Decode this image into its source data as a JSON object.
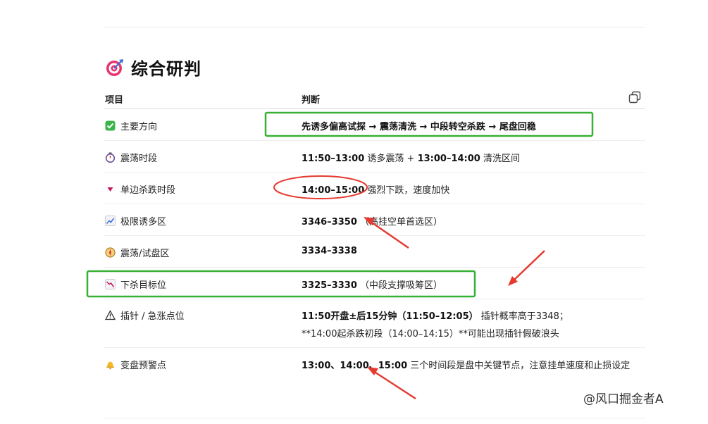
{
  "section": {
    "title": "综合研判"
  },
  "table": {
    "col_item": "项目",
    "col_judge": "判断",
    "rows": [
      {
        "item": "主要方向",
        "icon": "check-box-icon",
        "parts": [
          {
            "t": "先诱多偏高试探 → 震荡清洗 → 中段转空杀跌 → 尾盘回稳",
            "b": true
          }
        ]
      },
      {
        "item": "震荡时段",
        "icon": "stopwatch-icon",
        "parts": [
          {
            "t": "11:50–13:00",
            "b": true
          },
          {
            "t": " 诱多震荡 + ",
            "b": false
          },
          {
            "t": "13:00–14:00",
            "b": true
          },
          {
            "t": " 清洗区间",
            "b": false
          }
        ]
      },
      {
        "item": "单边杀跌时段",
        "icon": "down-triangle-icon",
        "parts": [
          {
            "t": "14:00–15:00",
            "b": true
          },
          {
            "t": " 强烈下跌，速度加快",
            "b": false
          }
        ]
      },
      {
        "item": "极限诱多区",
        "icon": "chart-up-icon",
        "parts": [
          {
            "t": "3346–3350",
            "b": true
          },
          {
            "t": " （高挂空单首选区）",
            "b": false
          }
        ]
      },
      {
        "item": "震荡/试盘区",
        "icon": "compass-icon",
        "parts": [
          {
            "t": "3334–3338",
            "b": true
          }
        ]
      },
      {
        "item": "下杀目标位",
        "icon": "chart-down-icon",
        "parts": [
          {
            "t": "3325–3330",
            "b": true
          },
          {
            "t": " （中段支撑吸筹区）",
            "b": false
          }
        ]
      },
      {
        "item": "插针 / 急涨点位",
        "icon": "warning-icon",
        "parts": [
          {
            "t": "11:50开盘±后15分钟（11:50–12:05）",
            "b": true
          },
          {
            "t": " 插针概率高于3348；",
            "b": false
          }
        ],
        "parts2": [
          {
            "t": "**14:00起杀跌初段（14:00–14:15）**可能出现插针假破浪头",
            "b": false
          }
        ]
      },
      {
        "item": "变盘预警点",
        "icon": "bell-icon",
        "parts": [
          {
            "t": "13:00、14:00、15:00",
            "b": true
          },
          {
            "t": " 三个时间段是盘中关键节点，注意挂单速度和止损设定",
            "b": false
          }
        ]
      }
    ]
  },
  "watermark": "@风口掘金者A",
  "colors": {
    "annotation_red": "#e53a2f",
    "annotation_green": "#38b034"
  }
}
